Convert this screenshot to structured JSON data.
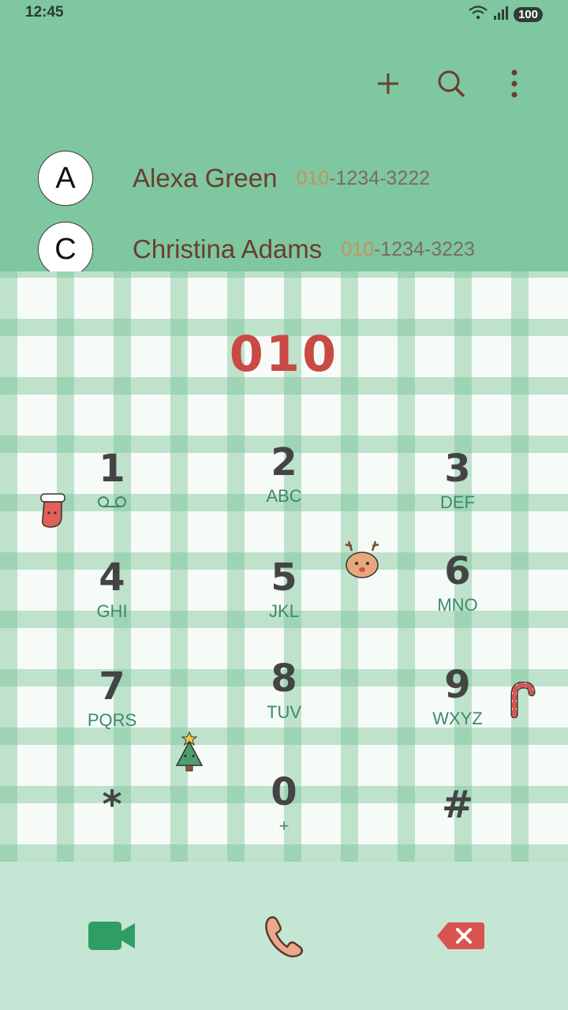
{
  "status": {
    "time": "12:45",
    "battery": "100"
  },
  "toolbar": {
    "add_icon": "plus-icon",
    "search_icon": "search-icon",
    "more_icon": "more-vertical-icon"
  },
  "contacts": [
    {
      "initial": "A",
      "name": "Alexa Green",
      "num_prefix": "010",
      "num_rest": "-1234-3222"
    },
    {
      "initial": "C",
      "name": "Christina Adams",
      "num_prefix": "010",
      "num_rest": "-1234-3223"
    }
  ],
  "dialer": {
    "entered": "010",
    "keys": [
      {
        "num": "1",
        "sub": ""
      },
      {
        "num": "2",
        "sub": "ABC"
      },
      {
        "num": "3",
        "sub": "DEF"
      },
      {
        "num": "4",
        "sub": "GHI"
      },
      {
        "num": "5",
        "sub": "JKL"
      },
      {
        "num": "6",
        "sub": "MNO"
      },
      {
        "num": "7",
        "sub": "PQRS"
      },
      {
        "num": "8",
        "sub": "TUV"
      },
      {
        "num": "9",
        "sub": "WXYZ"
      },
      {
        "num": "*",
        "sub": ""
      },
      {
        "num": "0",
        "sub": "+"
      },
      {
        "num": "#",
        "sub": ""
      }
    ]
  },
  "colors": {
    "header": "#7ec7a0",
    "digits": "#c94a43",
    "video": "#2f9e65",
    "call": "#e9a98a",
    "delete": "#d9534f"
  }
}
